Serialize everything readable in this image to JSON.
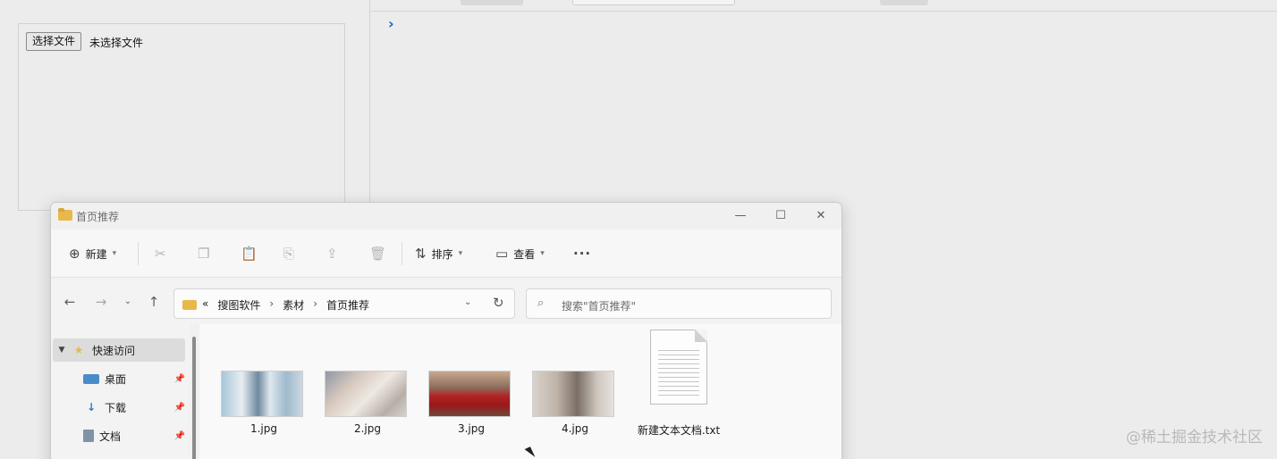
{
  "web_page": {
    "file_input": {
      "button_label": "选择文件",
      "status_text": "未选择文件"
    },
    "console": {
      "prompt_glyph": "›"
    },
    "watermark": "@稀土掘金技术社区"
  },
  "explorer": {
    "title": "首页推荐",
    "window_controls": {
      "minimize": "—",
      "maximize": "☐",
      "close": "✕"
    },
    "commands": {
      "new_label": "新建",
      "sort_label": "排序",
      "view_label": "查看",
      "more_label": "···"
    },
    "breadcrumb": {
      "overflow": "«",
      "segments": [
        "搜图软件",
        "素材",
        "首页推荐"
      ]
    },
    "search_placeholder": "搜索\"首页推荐\"",
    "nav_items": [
      {
        "label": "快速访问",
        "icon": "star-icon",
        "pinned": false
      },
      {
        "label": "桌面",
        "icon": "desktop-icon",
        "pinned": true
      },
      {
        "label": "下载",
        "icon": "download-icon",
        "pinned": true
      },
      {
        "label": "文档",
        "icon": "document-icon",
        "pinned": true
      }
    ],
    "files": [
      {
        "name": "1.jpg",
        "type": "image"
      },
      {
        "name": "2.jpg",
        "type": "image"
      },
      {
        "name": "3.jpg",
        "type": "image"
      },
      {
        "name": "4.jpg",
        "type": "image"
      },
      {
        "name": "新建文本文档.txt",
        "type": "text"
      }
    ]
  },
  "colors": {
    "accent": "#1a63c8",
    "folder": "#e8b84a"
  }
}
